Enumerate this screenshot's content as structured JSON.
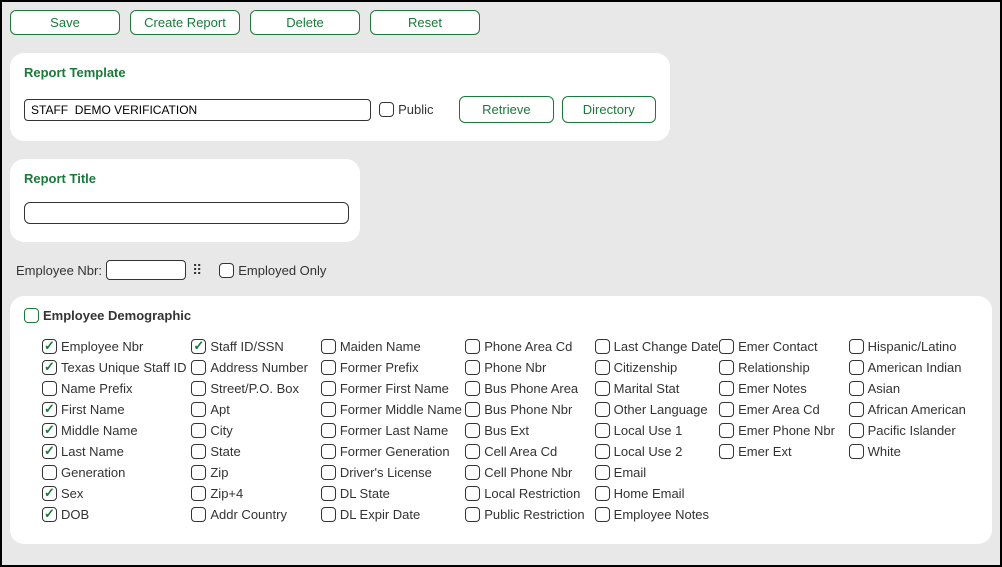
{
  "toolbar": {
    "save": "Save",
    "create_report": "Create Report",
    "delete": "Delete",
    "reset": "Reset"
  },
  "template": {
    "title": "Report Template",
    "value": "STAFF  DEMO VERIFICATION",
    "public_label": "Public",
    "public_checked": false,
    "retrieve": "Retrieve",
    "directory": "Directory"
  },
  "report_title": {
    "title": "Report Title",
    "value": ""
  },
  "filter": {
    "emp_nbr_label": "Employee Nbr:",
    "emp_nbr_value": "",
    "employed_only_label": "Employed Only",
    "employed_only_checked": false
  },
  "demo": {
    "header_label": "Employee Demographic",
    "header_checked": false,
    "columns": [
      [
        {
          "label": "Employee Nbr",
          "checked": true
        },
        {
          "label": "Texas Unique Staff ID",
          "checked": true
        },
        {
          "label": "Name Prefix",
          "checked": false
        },
        {
          "label": "First Name",
          "checked": true
        },
        {
          "label": "Middle Name",
          "checked": true
        },
        {
          "label": "Last Name",
          "checked": true
        },
        {
          "label": "Generation",
          "checked": false
        },
        {
          "label": "Sex",
          "checked": true
        },
        {
          "label": "DOB",
          "checked": true
        }
      ],
      [
        {
          "label": "Staff ID/SSN",
          "checked": true
        },
        {
          "label": "Address Number",
          "checked": false
        },
        {
          "label": "Street/P.O. Box",
          "checked": false
        },
        {
          "label": "Apt",
          "checked": false
        },
        {
          "label": "City",
          "checked": false
        },
        {
          "label": "State",
          "checked": false
        },
        {
          "label": "Zip",
          "checked": false
        },
        {
          "label": "Zip+4",
          "checked": false
        },
        {
          "label": "Addr Country",
          "checked": false
        }
      ],
      [
        {
          "label": "Maiden Name",
          "checked": false
        },
        {
          "label": "Former Prefix",
          "checked": false
        },
        {
          "label": "Former First Name",
          "checked": false
        },
        {
          "label": "Former Middle Name",
          "checked": false
        },
        {
          "label": "Former Last Name",
          "checked": false
        },
        {
          "label": "Former Generation",
          "checked": false
        },
        {
          "label": "Driver's License",
          "checked": false
        },
        {
          "label": "DL State",
          "checked": false
        },
        {
          "label": "DL Expir Date",
          "checked": false
        }
      ],
      [
        {
          "label": "Phone Area Cd",
          "checked": false
        },
        {
          "label": "Phone Nbr",
          "checked": false
        },
        {
          "label": "Bus Phone Area",
          "checked": false
        },
        {
          "label": "Bus Phone Nbr",
          "checked": false
        },
        {
          "label": "Bus Ext",
          "checked": false
        },
        {
          "label": "Cell Area Cd",
          "checked": false
        },
        {
          "label": "Cell Phone Nbr",
          "checked": false
        },
        {
          "label": "Local Restriction",
          "checked": false
        },
        {
          "label": "Public Restriction",
          "checked": false
        }
      ],
      [
        {
          "label": "Last Change Date",
          "checked": false
        },
        {
          "label": "Citizenship",
          "checked": false
        },
        {
          "label": "Marital Stat",
          "checked": false
        },
        {
          "label": "Other Language",
          "checked": false
        },
        {
          "label": "Local Use 1",
          "checked": false
        },
        {
          "label": "Local Use 2",
          "checked": false
        },
        {
          "label": "Email",
          "checked": false
        },
        {
          "label": "Home Email",
          "checked": false
        },
        {
          "label": "Employee Notes",
          "checked": false
        }
      ],
      [
        {
          "label": "Emer Contact",
          "checked": false
        },
        {
          "label": "Relationship",
          "checked": false
        },
        {
          "label": "Emer Notes",
          "checked": false
        },
        {
          "label": "Emer Area Cd",
          "checked": false
        },
        {
          "label": "Emer Phone Nbr",
          "checked": false
        },
        {
          "label": "Emer Ext",
          "checked": false
        }
      ],
      [
        {
          "label": "Hispanic/Latino",
          "checked": false
        },
        {
          "label": "American Indian",
          "checked": false
        },
        {
          "label": "Asian",
          "checked": false
        },
        {
          "label": "African American",
          "checked": false
        },
        {
          "label": "Pacific Islander",
          "checked": false
        },
        {
          "label": "White",
          "checked": false
        }
      ]
    ]
  }
}
